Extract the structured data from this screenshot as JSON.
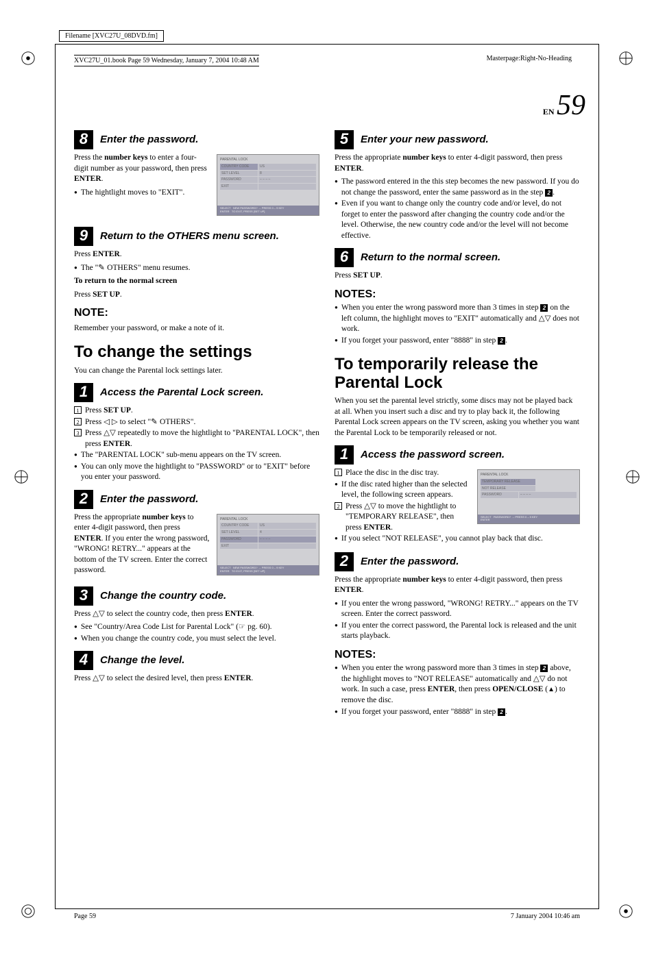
{
  "meta": {
    "filename": "Filename [XVC27U_08DVD.fm]",
    "masterpage": "Masterpage:Right-No-Heading",
    "bookinfo": "XVC27U_01.book  Page 59  Wednesday, January 7, 2004  10:48 AM",
    "pagenum_prefix": "EN",
    "pagenum": "59",
    "footer_left": "Page 59",
    "footer_right": "7 January 2004 10:46 am"
  },
  "left": {
    "step8": {
      "num": "8",
      "title": "Enter the password.",
      "p1a": "Press the ",
      "p1b": "number keys",
      "p1c": " to enter a four-digit number as your password, then press ",
      "p1d": "ENTER",
      "p1e": ".",
      "b1": "The hightlight moves to \"EXIT\"."
    },
    "osd1": {
      "header": "PARENTAL LOCK",
      "r1l": "COUNTRY CODE",
      "r1r": "US",
      "r2l": "SET LEVEL",
      "r2r": "8",
      "r3l": "PASSWORD",
      "r3r": "– – – –",
      "r4l": "EXIT",
      "r4r": "",
      "f1": "SELECT",
      "f2": "NEW PASSWORD? → PRESS 0 – 9 KEY",
      "f3": "ENTER",
      "f4": "TO EXIT, PRESS [SET UP]"
    },
    "step9": {
      "num": "9",
      "title": "Return to the OTHERS menu screen.",
      "p1a": "Press ",
      "p1b": "ENTER",
      "p1c": ".",
      "b1a": "The \"",
      "b1b": " OTHERS\" menu resumes.",
      "sub_head": "To return to the normal screen",
      "sub_p1a": "Press ",
      "sub_p1b": "SET UP",
      "sub_p1c": "."
    },
    "note1": {
      "head": "NOTE:",
      "body": "Remember your password, or make a note of it."
    },
    "h2a": "To change the settings",
    "h2a_sub": "You can change the Parental lock settings later.",
    "step1": {
      "num": "1",
      "title": "Access the Parental Lock screen.",
      "s1a": "Press ",
      "s1b": "SET UP",
      "s1c": ".",
      "s2a": "Press ◁ ▷ to select \"",
      "s2b": " OTHERS\".",
      "s3a": "Press △▽ repeatedly to move the hightlight to \"PARENTAL LOCK\", then press ",
      "s3b": "ENTER",
      "s3c": ".",
      "b1": "The \"PARENTAL LOCK\" sub-menu appears on the TV screen.",
      "b2": "You can only move the hightlight to \"PASSWORD\" or to \"EXIT\" before you enter your password."
    },
    "step2": {
      "num": "2",
      "title": "Enter the password.",
      "p1a": "Press the appropriate ",
      "p1b": "number keys",
      "p1c": " to enter 4-digit password, then press ",
      "p1d": "ENTER",
      "p1e": ". If you enter the wrong password, \"WRONG! RETRY...\" appears at the bottom of the TV screen. Enter the correct password."
    },
    "osd2": {
      "header": "PARENTAL LOCK",
      "r1l": "COUNTRY CODE",
      "r1r": "US",
      "r2l": "SET LEVEL",
      "r2r": "4",
      "r3l": "PASSWORD",
      "r3r": "– – – –",
      "r4l": "EXIT",
      "r4r": "",
      "f1": "SELECT",
      "f2": "NEW PASSWORD? → PRESS 0 – 9 KEY",
      "f3": "ENTER",
      "f4": "TO EXIT, PRESS [SET UP]"
    },
    "step3": {
      "num": "3",
      "title": "Change the country code.",
      "p1a": "Press △▽ to select the country code, then press ",
      "p1b": "ENTER",
      "p1c": ".",
      "b1": "See \"Country/Area Code List for Parental Lock\" (☞ pg. 60).",
      "b2": "When you change the country code, you must select the level."
    },
    "step4": {
      "num": "4",
      "title": "Change the level.",
      "p1a": "Press △▽ to select the desired level, then press ",
      "p1b": "ENTER",
      "p1c": "."
    }
  },
  "right": {
    "step5": {
      "num": "5",
      "title": "Enter your new password.",
      "p1a": "Press the appropriate ",
      "p1b": "number keys",
      "p1c": " to enter 4-digit password, then press ",
      "p1d": "ENTER",
      "p1e": ".",
      "b1a": "The password entered in the this step becomes the new password. If you do not change the password, enter the same password as in the step ",
      "b1b": ".",
      "b2": "Even if you want to change only the country code and/or level, do not forget to enter the password after changing the country code and/or the level. Otherwise, the new country code and/or the level will not become effective."
    },
    "step6": {
      "num": "6",
      "title": "Return to the normal screen.",
      "p1a": "Press ",
      "p1b": "SET UP",
      "p1c": "."
    },
    "notes1": {
      "head": "NOTES:",
      "b1a": "When you enter the wrong password more than 3 times in step ",
      "b1b": " on the left column, the highlight moves to \"EXIT\" automatically and △▽ does not work.",
      "b2a": "If you forget your password, enter \"8888\" in step ",
      "b2b": "."
    },
    "h2b": "To temporarily release the Parental Lock",
    "h2b_sub": "When you set the parental level strictly, some discs may not be played back at all. When you insert such a disc and try to play back it, the following Parental Lock screen appears on the TV screen, asking you whether you want the Parental Lock to be temporarily released or not.",
    "stepR1": {
      "num": "1",
      "title": "Access the password screen.",
      "s1": "Place the disc in the disc tray.",
      "b1": "If the disc rated higher than the selected level, the following screen appears.",
      "s2a": "Press △▽ to move the hightlight to \"TEMPORARY RELEASE\", then press ",
      "s2b": "ENTER",
      "s2c": ".",
      "b2": "If you select \"NOT RELEASE\", you cannot play back that disc."
    },
    "osd3": {
      "header": "PARENTAL LOCK",
      "r1l": "TEMPORARY RELEASE",
      "r1r": "",
      "r2l": "NOT RELEASE",
      "r2r": "",
      "r3l": "PASSWORD",
      "r3r": "– – – –",
      "f1": "SELECT",
      "f2": "PASSWORD? → PRESS 0 – 9 KEY",
      "f3": "ENTER"
    },
    "stepR2": {
      "num": "2",
      "title": "Enter the password.",
      "p1a": "Press the appropriate ",
      "p1b": "number keys",
      "p1c": " to enter 4-digit password, then press ",
      "p1d": "ENTER",
      "p1e": ".",
      "b1": "If you enter the wrong password, \"WRONG! RETRY...\" appears on the TV screen. Enter the correct password.",
      "b2": "If you enter the correct password, the Parental lock is released and the unit starts playback."
    },
    "notes2": {
      "head": "NOTES:",
      "b1a": "When you enter the wrong password more than 3 times in step ",
      "b1b": " above, the highlight moves to \"NOT RELEASE\" automatically and △▽ do not work. In such a case, press ",
      "b1c": "ENTER",
      "b1d": ", then press ",
      "b1e": "OPEN/CLOSE",
      "b1f": " (",
      "b1g": ") to remove the disc.",
      "b2a": "If you forget your password, enter \"8888\" in step ",
      "b2b": "."
    }
  }
}
